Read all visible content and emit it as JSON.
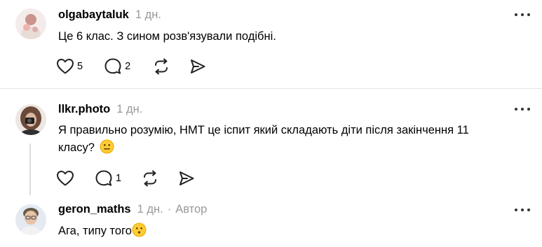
{
  "comments": [
    {
      "username": "olgabaytaluk",
      "time": "1 дн.",
      "text": "Це 6 клас. З сином розв'язували подібні.",
      "likes": "5",
      "replies": "2",
      "avatar_icon": "avatar-photo"
    },
    {
      "username": "llkr.photo",
      "time": "1 дн.",
      "text_line1": "Я правильно розумію, НМТ це іспит який складають діти після закінчення 11",
      "text_line2": "класу?",
      "emoji": "neutral-face",
      "likes": "",
      "replies": "1",
      "avatar_icon": "avatar-photo"
    },
    {
      "username": "geron_maths",
      "time": "1 дн.",
      "separator": "·",
      "badge": "Автор",
      "text": "Ага, типу того",
      "emoji": "hushed-face",
      "avatar_icon": "avatar-photo"
    }
  ],
  "colors": {
    "secondary_text": "#999999",
    "divider": "#e3e3e3",
    "emoji": "#ffcc33"
  }
}
